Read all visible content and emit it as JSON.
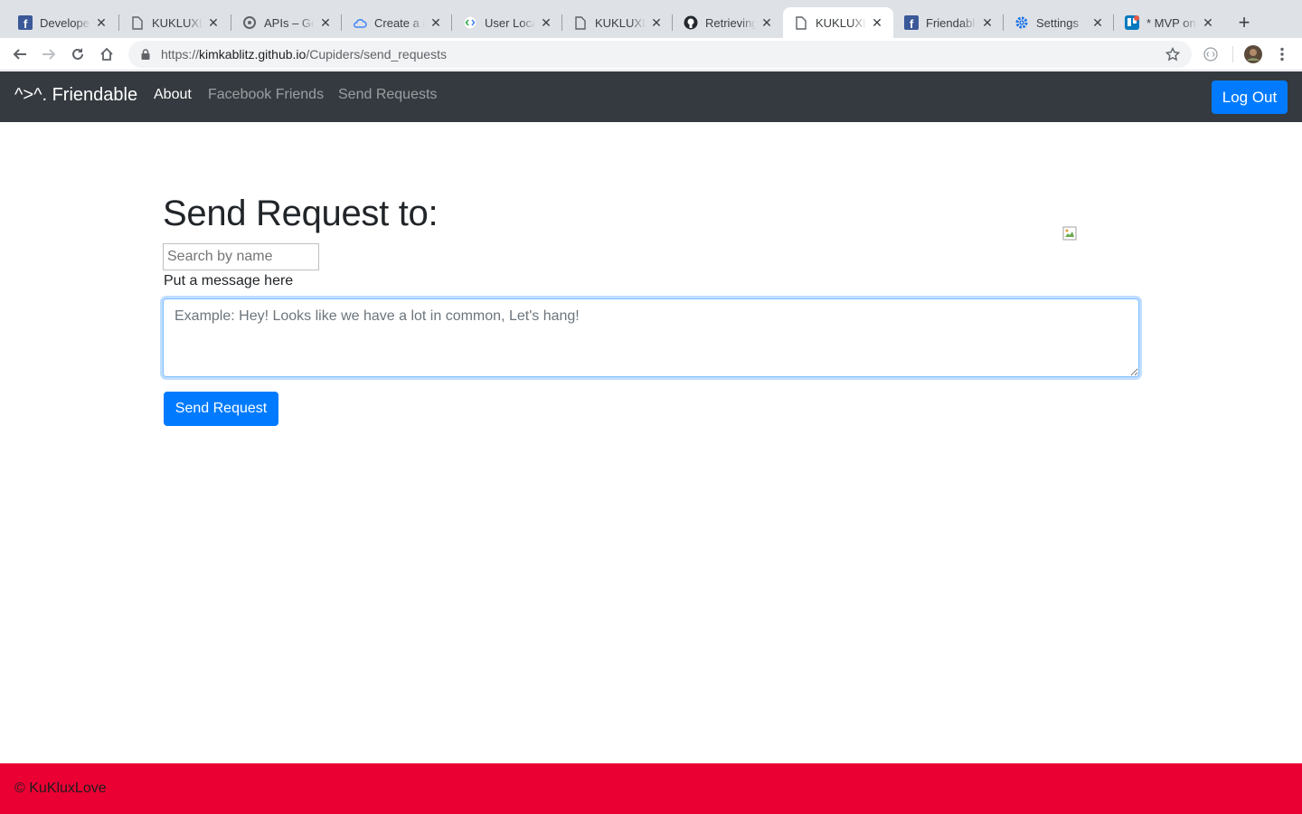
{
  "browser": {
    "tabs": [
      {
        "title": "Developers",
        "icon": "facebook-icon"
      },
      {
        "title": "KUKLUXLOVE",
        "icon": "document-icon"
      },
      {
        "title": "APIs – Google",
        "icon": "api-icon"
      },
      {
        "title": "Create a new",
        "icon": "cloud-icon"
      },
      {
        "title": "User Location",
        "icon": "code-icon"
      },
      {
        "title": "KUKLUXLOVE",
        "icon": "document-icon"
      },
      {
        "title": "Retrieving",
        "icon": "github-icon"
      },
      {
        "title": "KUKLUXLOVE",
        "icon": "document-icon",
        "active": true
      },
      {
        "title": "Friendable",
        "icon": "facebook-icon"
      },
      {
        "title": "Settings",
        "icon": "gear-icon"
      },
      {
        "title": "* MVP on",
        "icon": "trello-icon"
      }
    ],
    "address": {
      "scheme": "https://",
      "host": "kimkablitz.github.io",
      "path": "/Cupiders/send_requests"
    }
  },
  "navbar": {
    "brand": "^>^. Friendable",
    "links": [
      {
        "label": "About",
        "active": true
      },
      {
        "label": "Facebook Friends",
        "active": false
      },
      {
        "label": "Send Requests",
        "active": false
      }
    ],
    "logout_label": "Log Out"
  },
  "main": {
    "heading": "Send Request to:",
    "search_placeholder": "Search by name",
    "message_label": "Put a message here",
    "message_placeholder": "Example: Hey! Looks like we have a lot in common, Let's hang!",
    "send_label": "Send Request"
  },
  "footer": {
    "text": "© KuKluxLove"
  },
  "colors": {
    "navbar": "#343a40",
    "primary": "#007bff",
    "footer": "#eb0034"
  }
}
